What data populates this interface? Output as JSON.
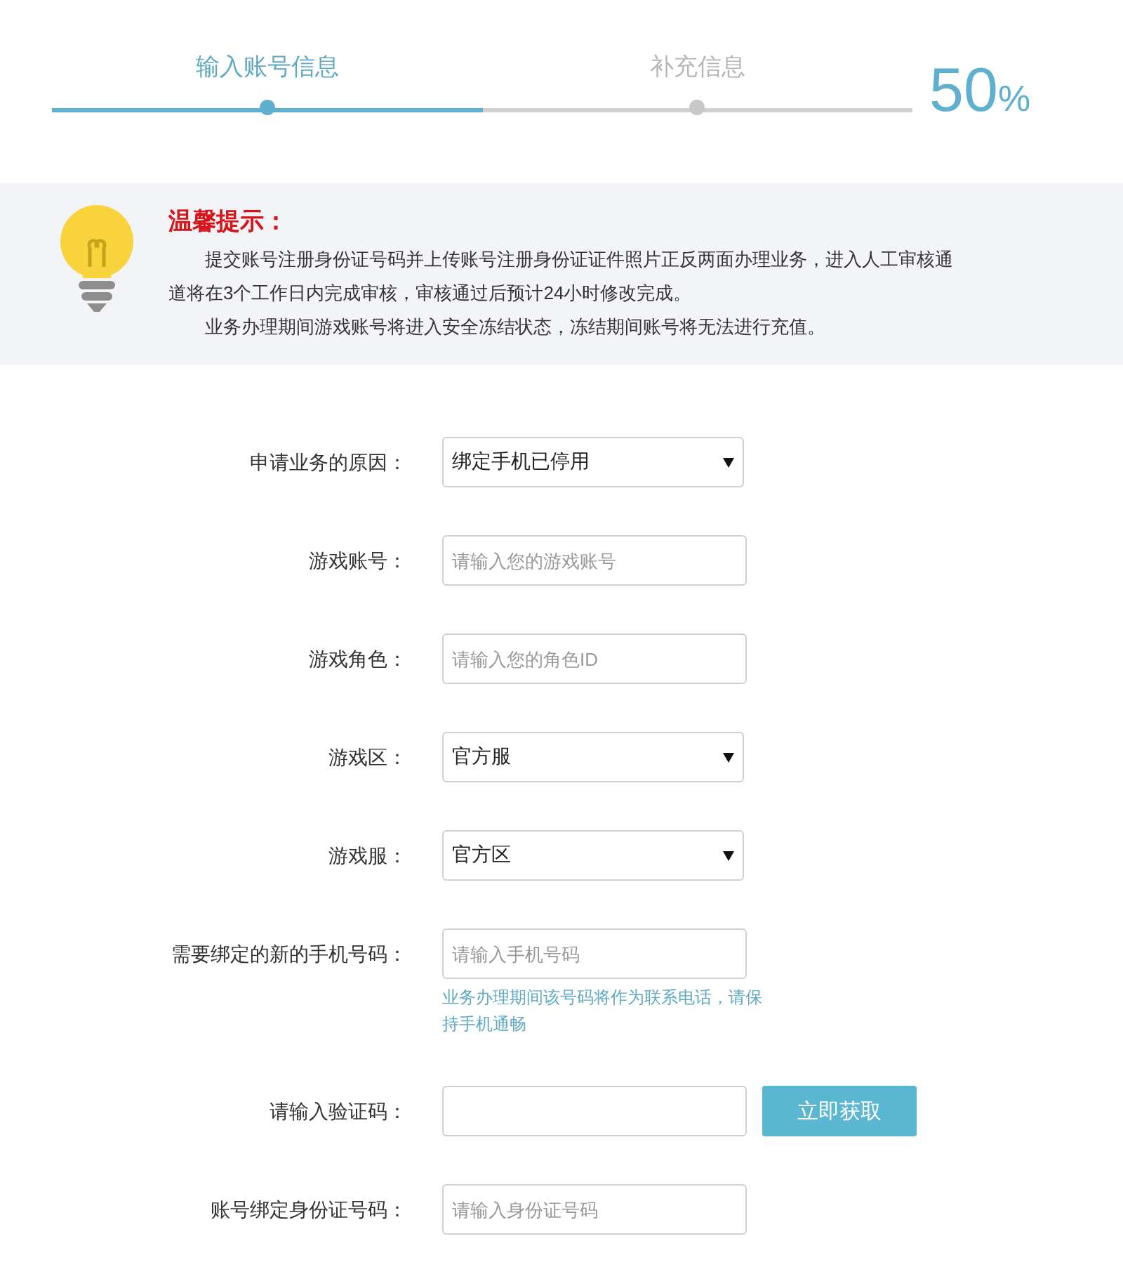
{
  "progress": {
    "steps": [
      {
        "label": "输入账号信息",
        "selected": true
      },
      {
        "label": "补充信息",
        "selected": false
      }
    ],
    "level": 0.5,
    "percent": "50",
    "unit": "%"
  },
  "notice": {
    "title": "温馨提示：",
    "paragraphs": [
      "提交账号注册身份证号码并上传账号注册身份证证件照片正反两面办理业务，进入人工审核通道将在3个工作日内完成审核，审核通过后预计24小时修改完成。",
      "业务办理期间游戏账号将进入安全冻结状态，冻结期间账号将无法进行充值。"
    ]
  },
  "form": {
    "fields": [
      {
        "label": "申请业务的原因：",
        "kind": "select",
        "value": "绑定手机已停用"
      },
      {
        "label": "游戏账号：",
        "kind": "input",
        "placeholder": "请输入您的游戏账号"
      },
      {
        "label": "游戏角色：",
        "kind": "input",
        "placeholder": "请输入您的角色ID"
      },
      {
        "label": "游戏区：",
        "kind": "select",
        "value": "官方服"
      },
      {
        "label": "游戏服：",
        "kind": "select",
        "value": "官方区"
      },
      {
        "label": "需要绑定的新的手机号码：",
        "kind": "input",
        "placeholder": "请输入手机号码",
        "hint": "业务办理期间该号码将作为联系电话，请保持手机通畅"
      },
      {
        "label": "请输入验证码：",
        "kind": "input",
        "action": "立即获取"
      },
      {
        "label": "账号绑定身份证号码：",
        "kind": "input",
        "placeholder": "请输入身份证号码"
      }
    ]
  }
}
